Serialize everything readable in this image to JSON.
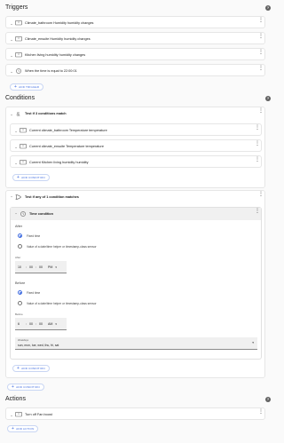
{
  "triggers": {
    "title": "Triggers",
    "items": [
      {
        "label": "Climate_bathroom Humidity humidity changes",
        "icon": "device-icon"
      },
      {
        "label": "Climate_ensuite Humidity humidity changes",
        "icon": "device-icon"
      },
      {
        "label": "Kitchen living humidity humidity changes",
        "icon": "device-icon"
      },
      {
        "label": "When the time is equal to 22:00:01",
        "icon": "clock-icon"
      }
    ],
    "add_label": "ADD TRIGGER"
  },
  "conditions": {
    "title": "Conditions",
    "group1": {
      "label": "Test if 3 conditions match",
      "items": [
        {
          "label": "Current climate_bathroom Temperature temperature"
        },
        {
          "label": "Current climate_ensuite Temperature temperature"
        },
        {
          "label": "Current Kitchen living humidity humidity"
        }
      ],
      "add_label": "ADD CONDITION"
    },
    "group2": {
      "label": "Test if any of 1 condition matches",
      "time_condition": {
        "label": "Time condition",
        "after": {
          "heading": "After",
          "opt_fixed": "Fixed time",
          "opt_helper": "Value of a date/time helper or timestamp-class sensor",
          "time_label": "After",
          "hour": "10",
          "minute": "00",
          "second": "00",
          "ampm": "PM"
        },
        "before": {
          "heading": "Before",
          "opt_fixed": "Fixed time",
          "opt_helper": "Value of a date/time helper or timestamp-class sensor",
          "time_label": "Before",
          "hour": "6",
          "minute": "00",
          "second": "00",
          "ampm": "AM"
        },
        "weekdays_label": "Weekdays",
        "weekdays_value": "sun, mon, tue, wed, thu, fri, sat"
      },
      "add_label": "ADD CONDITION"
    },
    "add_label": "ADD CONDITION"
  },
  "actions": {
    "title": "Actions",
    "items": [
      {
        "label": "Turn off Fan boost"
      }
    ],
    "add_label": "ADD ACTION"
  },
  "colors": {
    "accent": "#3d6ae0"
  }
}
